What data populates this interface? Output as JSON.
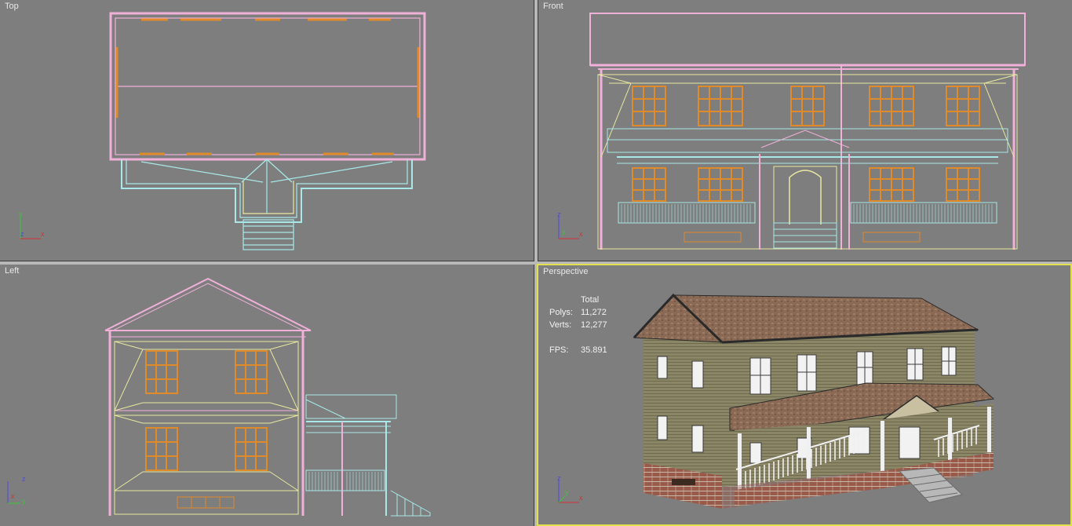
{
  "viewports": {
    "top": {
      "label": "Top"
    },
    "front": {
      "label": "Front"
    },
    "left": {
      "label": "Left"
    },
    "perspective": {
      "label": "Perspective",
      "active": true,
      "highlight_color": "#e3e04f"
    }
  },
  "stats": {
    "header": "Total",
    "polys_label": "Polys:",
    "polys_value": "11,272",
    "verts_label": "Verts:",
    "verts_value": "12,277",
    "fps_label": "FPS:",
    "fps_value": "35.891"
  },
  "axes": {
    "top": {
      "a": "y",
      "b": "x",
      "c": "z"
    },
    "front": {
      "a": "z",
      "b": "x",
      "c": "y"
    },
    "left": {
      "a": "z",
      "b": "y",
      "c": "x"
    },
    "perspective": {
      "a": "z",
      "b": "x",
      "c": "y"
    }
  },
  "colors": {
    "viewport_bg": "#7e7e7e",
    "wire_pink": "#f0b0d8",
    "wire_cyan": "#a8e8e8",
    "wire_yellow": "#e8e8a0",
    "wire_orange": "#e08a2a"
  }
}
